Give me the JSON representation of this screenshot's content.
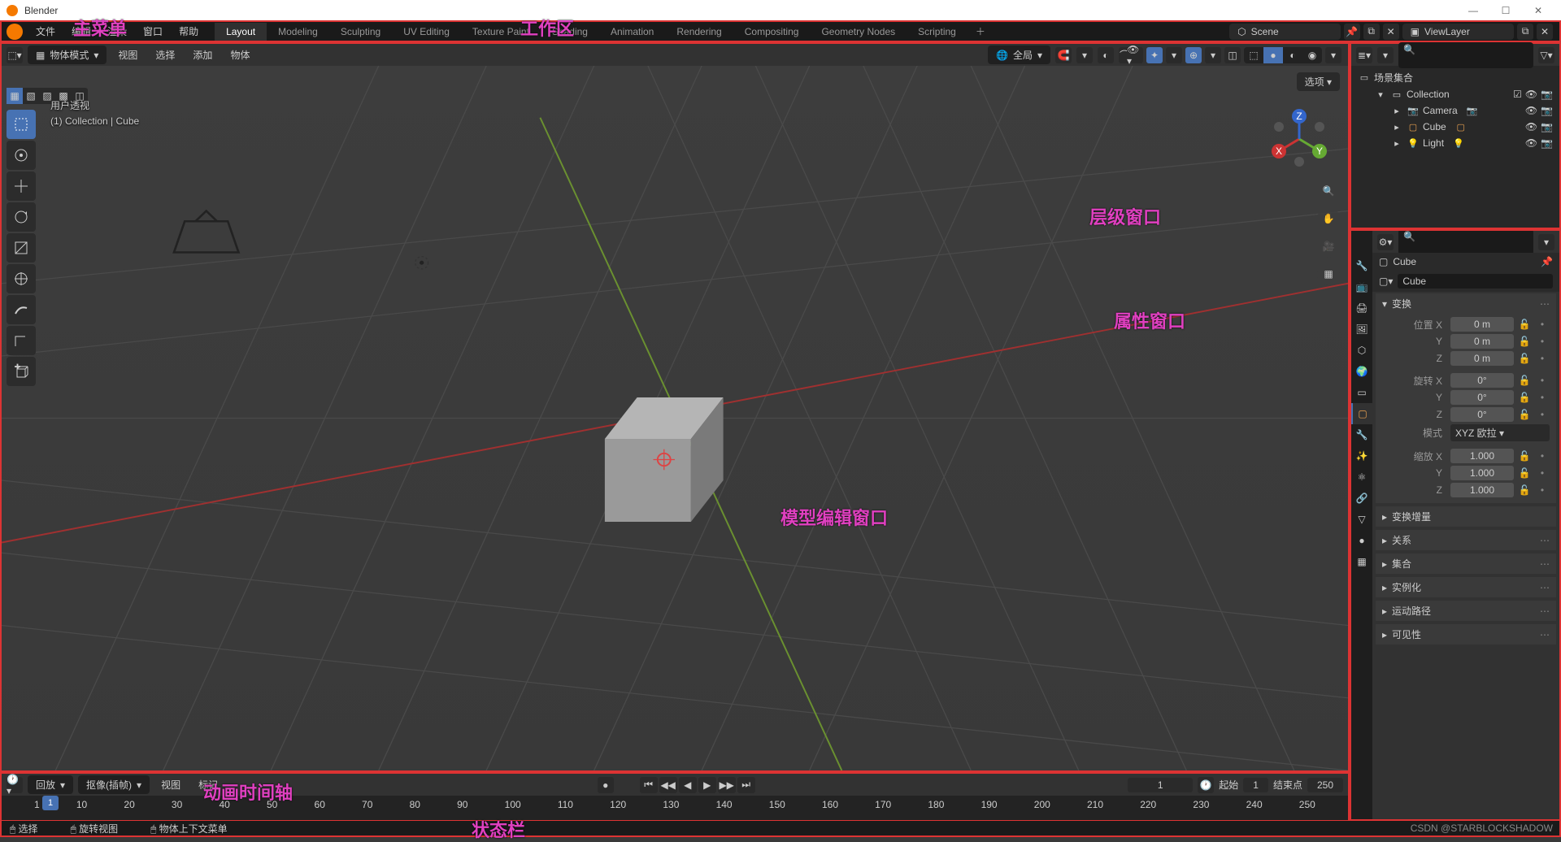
{
  "window_title": "Blender",
  "menu": {
    "file": "文件",
    "edit": "编辑",
    "render": "渲染",
    "window": "窗口",
    "help": "帮助"
  },
  "workspaces": [
    "Layout",
    "Modeling",
    "Sculpting",
    "UV Editing",
    "Texture Paint",
    "Shading",
    "Animation",
    "Rendering",
    "Compositing",
    "Geometry Nodes",
    "Scripting"
  ],
  "active_workspace": 0,
  "scene_name": "Scene",
  "viewlayer_name": "ViewLayer",
  "viewport": {
    "mode": "物体模式",
    "menus": {
      "view": "视图",
      "select": "选择",
      "add": "添加",
      "object": "物体"
    },
    "orientation": "全局",
    "overlay_title": "用户透视",
    "overlay_sub": "(1) Collection | Cube",
    "options_label": "选项"
  },
  "outliner": {
    "root": "场景集合",
    "collection": "Collection",
    "items": [
      "Camera",
      "Cube",
      "Light"
    ]
  },
  "properties": {
    "crumb": "Cube",
    "object": "Cube",
    "panels": {
      "transform": "变换",
      "delta": "变换增量",
      "relations": "关系",
      "collections": "集合",
      "instancing": "实例化",
      "motion": "运动路径",
      "visibility": "可见性"
    },
    "location_label": "位置",
    "rotation_label": "旋转",
    "scale_label": "缩放",
    "mode_label": "模式",
    "axes": [
      "X",
      "Y",
      "Z"
    ],
    "location": [
      "0 m",
      "0 m",
      "0 m"
    ],
    "rotation": [
      "0°",
      "0°",
      "0°"
    ],
    "rotation_mode": "XYZ 欧拉",
    "scale": [
      "1.000",
      "1.000",
      "1.000"
    ]
  },
  "timeline": {
    "playback": "回放",
    "keying": "抠像(插帧)",
    "view": "视图",
    "marker": "标记",
    "current": "1",
    "start_label": "起始",
    "start": "1",
    "end_label": "结束点",
    "end": "250",
    "ticks": [
      "1",
      "10",
      "20",
      "30",
      "40",
      "50",
      "60",
      "70",
      "80",
      "90",
      "100",
      "110",
      "120",
      "130",
      "140",
      "150",
      "160",
      "170",
      "180",
      "190",
      "200",
      "210",
      "220",
      "230",
      "240",
      "250"
    ]
  },
  "statusbar": {
    "select": "选择",
    "rotate": "旋转视图",
    "context": "物体上下文菜单"
  },
  "annotations": {
    "main_menu": "主菜单",
    "workspace": "工作区",
    "outliner": "层级窗口",
    "properties": "属性窗口",
    "viewport": "模型编辑窗口",
    "timeline": "动画时间轴",
    "statusbar": "状态栏"
  },
  "watermark": "CSDN @STARBLOCKSHADOW"
}
